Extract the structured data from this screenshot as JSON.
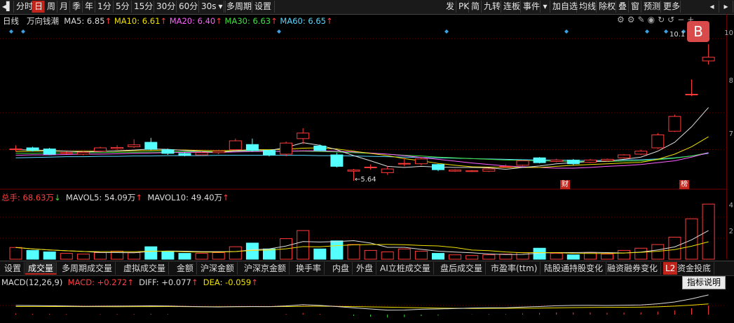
{
  "toolbar": {
    "left_items": [
      {
        "label": "分时",
        "active": false
      },
      {
        "label": "日",
        "active": true
      },
      {
        "label": "周",
        "active": false
      },
      {
        "label": "月",
        "active": false
      },
      {
        "label": "季",
        "active": false
      },
      {
        "label": "年",
        "active": false
      },
      {
        "label": "1分",
        "active": false
      },
      {
        "label": "5分",
        "active": false
      },
      {
        "label": "15分",
        "active": false
      },
      {
        "label": "30分",
        "active": false
      },
      {
        "label": "60分",
        "active": false
      },
      {
        "label": "30s",
        "active": false
      },
      {
        "label": "多周期",
        "active": false
      },
      {
        "label": "设置",
        "active": false
      }
    ],
    "right_items": [
      "发",
      "PK",
      "简",
      "九转",
      "连板",
      "事件",
      "加自选",
      "均线",
      "除权",
      "叠",
      "窗",
      "预测",
      "更多"
    ]
  },
  "chart_info": {
    "period": "日线",
    "stock_name": "万向钱潮",
    "ma": [
      {
        "label": "MA5: 6.85",
        "arrow": "↑",
        "color": "#dddddd"
      },
      {
        "label": "MA10: 6.61",
        "arrow": "↑",
        "color": "#f0e000"
      },
      {
        "label": "MA20: 6.40",
        "arrow": "↑",
        "color": "#ff60ff"
      },
      {
        "label": "MA30: 6.63",
        "arrow": "↑",
        "color": "#40e040"
      },
      {
        "label": "MA60: 6.65",
        "arrow": "↑",
        "color": "#5ad8ff"
      }
    ]
  },
  "price_axis": [
    "10",
    "8",
    "7"
  ],
  "volume_axis": [
    "4",
    "2"
  ],
  "annotations": {
    "high_label": "10.1",
    "low_label": "5.64",
    "cai_badge": "财",
    "bang_badge": "榜",
    "b_badge": "B"
  },
  "volume_info": {
    "total": "总手: 68.63万",
    "total_arrow": "↓",
    "mavol5": "MAVOL5: 54.09万",
    "mavol5_arrow": "↑",
    "mavol10": "MAVOL10: 49.40万",
    "mavol10_arrow": "↑"
  },
  "indicator_tabs": [
    "设置",
    "成交量",
    "多周期成交量",
    "虚拟成交量",
    "金额",
    "沪深金额",
    "沪深京金额",
    "换手率",
    "内盘",
    "外盘",
    "AI立桩成交量",
    "盘后成交量",
    "市盈率(ttm)",
    "陆股通持股变化",
    "融资融券变化",
    "L2",
    "资金投底"
  ],
  "macd_info": {
    "title": "MACD(12,26,9)",
    "macd": "MACD: +0.272",
    "macd_arrow": "↑",
    "diff": "DIFF: +0.077",
    "diff_arrow": "↑",
    "dea": "DEA: -0.059",
    "dea_arrow": "↑"
  },
  "tooltip": "指标说明",
  "chart_data": {
    "type": "candlestick",
    "candles": [
      {
        "o": 7.02,
        "c": 7.02,
        "h": 7.12,
        "l": 6.95
      },
      {
        "o": 7.05,
        "c": 6.98,
        "h": 7.08,
        "l": 6.95
      },
      {
        "o": 7.02,
        "c": 6.88,
        "h": 7.05,
        "l": 6.85
      },
      {
        "o": 6.9,
        "c": 6.92,
        "h": 6.95,
        "l": 6.88
      },
      {
        "o": 6.88,
        "c": 6.93,
        "h": 6.97,
        "l": 6.85
      },
      {
        "o": 6.96,
        "c": 7.05,
        "h": 7.08,
        "l": 6.93
      },
      {
        "o": 7.03,
        "c": 7.06,
        "h": 7.12,
        "l": 7.0
      },
      {
        "o": 7.08,
        "c": 7.13,
        "h": 7.28,
        "l": 7.05
      },
      {
        "o": 7.2,
        "c": 7.01,
        "h": 7.32,
        "l": 6.98
      },
      {
        "o": 7.0,
        "c": 6.9,
        "h": 7.03,
        "l": 6.86
      },
      {
        "o": 6.9,
        "c": 6.85,
        "h": 6.93,
        "l": 6.82
      },
      {
        "o": 6.86,
        "c": 6.92,
        "h": 6.96,
        "l": 6.84
      },
      {
        "o": 6.92,
        "c": 6.96,
        "h": 7.0,
        "l": 6.88
      },
      {
        "o": 7.0,
        "c": 7.24,
        "h": 7.3,
        "l": 6.98
      },
      {
        "o": 7.14,
        "c": 6.98,
        "h": 7.3,
        "l": 6.94
      },
      {
        "o": 6.98,
        "c": 6.86,
        "h": 7.0,
        "l": 6.82
      },
      {
        "o": 6.88,
        "c": 7.18,
        "h": 7.22,
        "l": 6.82
      },
      {
        "o": 7.3,
        "c": 7.45,
        "h": 7.58,
        "l": 7.15
      },
      {
        "o": 7.1,
        "c": 6.98,
        "h": 7.14,
        "l": 6.96
      },
      {
        "o": 6.86,
        "c": 6.55,
        "h": 6.92,
        "l": 6.52
      },
      {
        "o": 6.42,
        "c": 6.45,
        "h": 6.48,
        "l": 6.16
      },
      {
        "o": 6.52,
        "c": 6.53,
        "h": 6.6,
        "l": 6.46
      },
      {
        "o": 6.38,
        "c": 6.48,
        "h": 6.55,
        "l": 6.32
      },
      {
        "o": 6.62,
        "c": 6.63,
        "h": 6.78,
        "l": 6.55
      },
      {
        "o": 6.62,
        "c": 6.75,
        "h": 6.8,
        "l": 6.58
      },
      {
        "o": 6.6,
        "c": 6.46,
        "h": 6.62,
        "l": 6.42
      },
      {
        "o": 6.42,
        "c": 6.45,
        "h": 6.47,
        "l": 6.4
      },
      {
        "o": 6.41,
        "c": 6.43,
        "h": 6.45,
        "l": 6.4
      },
      {
        "o": 6.42,
        "c": 6.48,
        "h": 6.5,
        "l": 6.4
      },
      {
        "o": 6.55,
        "c": 6.55,
        "h": 6.6,
        "l": 6.52
      },
      {
        "o": 6.58,
        "c": 6.7,
        "h": 6.73,
        "l": 6.56
      },
      {
        "o": 6.78,
        "c": 6.65,
        "h": 6.8,
        "l": 6.63
      },
      {
        "o": 6.68,
        "c": 6.72,
        "h": 6.75,
        "l": 6.66
      },
      {
        "o": 6.72,
        "c": 6.62,
        "h": 6.75,
        "l": 6.58
      },
      {
        "o": 6.66,
        "c": 6.72,
        "h": 6.75,
        "l": 6.64
      },
      {
        "o": 6.7,
        "c": 6.74,
        "h": 6.76,
        "l": 6.67
      },
      {
        "o": 6.78,
        "c": 6.86,
        "h": 6.88,
        "l": 6.76
      },
      {
        "o": 6.88,
        "c": 6.96,
        "h": 7.0,
        "l": 6.86
      },
      {
        "o": 7.05,
        "c": 7.4,
        "h": 7.45,
        "l": 7.02
      },
      {
        "o": 7.5,
        "c": 7.9,
        "h": 7.95,
        "l": 7.48
      },
      {
        "o": 8.5,
        "c": 8.5,
        "h": 8.9,
        "l": 8.45
      },
      {
        "o": 9.4,
        "c": 9.5,
        "h": 9.85,
        "l": 9.3
      }
    ],
    "volumes": [
      16,
      12,
      10,
      8,
      7,
      9,
      11,
      9,
      17,
      10,
      8,
      8,
      9,
      17,
      22,
      14,
      28,
      39,
      14,
      25,
      20,
      12,
      10,
      14,
      11,
      8,
      6,
      5,
      6,
      7,
      9,
      15,
      8,
      6,
      9,
      7,
      12,
      15,
      20,
      30,
      55,
      75
    ],
    "ma5": [
      7.0,
      6.99,
      6.98,
      6.96,
      6.94,
      6.95,
      6.97,
      6.99,
      7.02,
      7.01,
      6.98,
      6.95,
      6.92,
      6.97,
      6.99,
      6.98,
      7.06,
      7.19,
      7.12,
      7.0,
      6.84,
      6.7,
      6.55,
      6.52,
      6.55,
      6.53,
      6.52,
      6.52,
      6.51,
      6.47,
      6.52,
      6.56,
      6.62,
      6.65,
      6.68,
      6.69,
      6.74,
      6.8,
      6.96,
      7.2,
      7.62,
      8.14
    ],
    "ma10": [
      6.95,
      6.96,
      6.96,
      6.96,
      6.96,
      6.96,
      6.96,
      6.97,
      6.98,
      6.99,
      6.99,
      6.98,
      6.97,
      6.98,
      7.0,
      7.0,
      7.01,
      7.04,
      7.05,
      7.02,
      6.96,
      6.9,
      6.84,
      6.76,
      6.7,
      6.63,
      6.58,
      6.54,
      6.53,
      6.52,
      6.52,
      6.52,
      6.55,
      6.58,
      6.6,
      6.62,
      6.64,
      6.66,
      6.74,
      6.88,
      7.08,
      7.35
    ],
    "ma20": [
      6.85,
      6.86,
      6.86,
      6.87,
      6.88,
      6.88,
      6.89,
      6.9,
      6.91,
      6.92,
      6.93,
      6.93,
      6.93,
      6.94,
      6.95,
      6.95,
      6.96,
      6.97,
      6.97,
      6.96,
      6.94,
      6.91,
      6.88,
      6.84,
      6.79,
      6.74,
      6.69,
      6.64,
      6.6,
      6.56,
      6.54,
      6.52,
      6.5,
      6.5,
      6.52,
      6.55,
      6.57,
      6.6,
      6.65,
      6.7,
      6.8,
      6.92
    ],
    "ma30": [
      6.9,
      6.9,
      6.91,
      6.91,
      6.92,
      6.92,
      6.93,
      6.93,
      6.94,
      6.94,
      6.95,
      6.95,
      6.95,
      6.96,
      6.96,
      6.96,
      6.96,
      6.96,
      6.95,
      6.94,
      6.92,
      6.9,
      6.88,
      6.85,
      6.83,
      6.8,
      6.78,
      6.76,
      6.74,
      6.72,
      6.71,
      6.7,
      6.69,
      6.68,
      6.68,
      6.68,
      6.69,
      6.7,
      6.73,
      6.77,
      6.83,
      6.92
    ],
    "ma60": [
      6.78,
      6.79,
      6.8,
      6.81,
      6.81,
      6.82,
      6.82,
      6.83,
      6.83,
      6.84,
      6.84,
      6.84,
      6.85,
      6.85,
      6.85,
      6.85,
      6.85,
      6.85,
      6.84,
      6.84,
      6.83,
      6.82,
      6.81,
      6.8,
      6.79,
      6.78,
      6.77,
      6.76,
      6.75,
      6.74,
      6.73,
      6.72,
      6.72,
      6.71,
      6.71,
      6.71,
      6.72,
      6.73,
      6.75,
      6.78,
      6.83,
      6.9
    ]
  }
}
